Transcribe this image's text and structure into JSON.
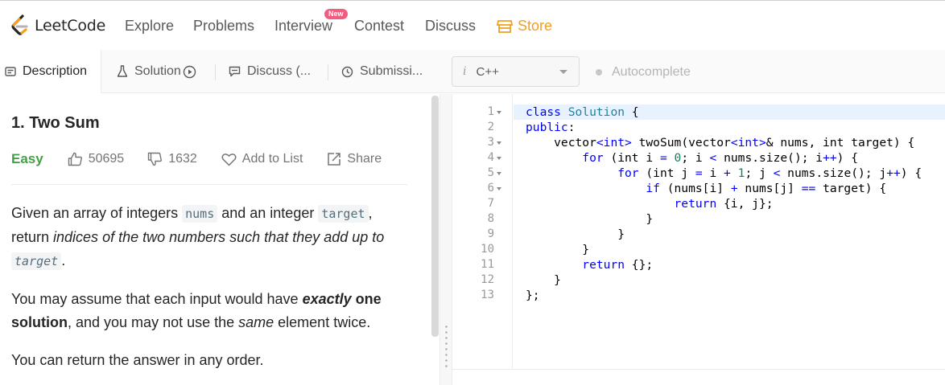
{
  "nav": {
    "logo_text": "LeetCode",
    "links": [
      "Explore",
      "Problems",
      "Interview",
      "Contest",
      "Discuss",
      "Store"
    ],
    "new_badge": "New",
    "store_color": "#f0a020"
  },
  "left_tabs": {
    "description": "Description",
    "solution": "Solution",
    "discuss": "Discuss (...",
    "submissions": "Submissi..."
  },
  "editor_toolbar": {
    "lang_icon": "i",
    "language": "C++",
    "autocomplete": "Autocomplete"
  },
  "problem": {
    "title": "1. Two Sum",
    "difficulty": "Easy",
    "difficulty_color": "#43a047",
    "likes": "50695",
    "dislikes": "1632",
    "add_to_list": "Add to List",
    "share": "Share",
    "p1": {
      "a": "Given an array of integers ",
      "code1": "nums",
      "b": " and an integer ",
      "code2": "target",
      "c": ", return ",
      "em": "indices of the two numbers such that they add up to",
      "d": " ",
      "code3": "target",
      "e": "."
    },
    "p2": {
      "a": "You may assume that each input would have ",
      "strong_em": "exactly",
      "strong": " one solution",
      "b": ", and you may not use the ",
      "em": "same",
      "c": " element twice."
    },
    "p3": "You can return the answer in any order."
  },
  "code": {
    "line_numbers": [
      "1",
      "2",
      "3",
      "4",
      "5",
      "6",
      "7",
      "8",
      "9",
      "10",
      "11",
      "12",
      "13"
    ],
    "l1_kw": "class",
    "l1_name": "Solution",
    "l1_rest": " {",
    "l2_kw": "public",
    "l2_rest": ":",
    "l3_a": "    vector",
    "l3_b": "<int>",
    "l3_c": " twoSum(vector",
    "l3_d": "<int>",
    "l3_e": "& nums, int target) {",
    "l4_kw": "for",
    "l4_a": " (int i ",
    "l4_eq": "=",
    "l4_sp": " ",
    "l4_n0": "0",
    "l4_b": "; i ",
    "l4_lt": "<",
    "l4_c": " nums.size(); i",
    "l4_pp": "++",
    "l4_d": ") {",
    "l5_kw": "for",
    "l5_a": " (int j ",
    "l5_eq": "=",
    "l5_b": " i ",
    "l5_plus": "+",
    "l5_sp": " ",
    "l5_n1": "1",
    "l5_c": "; j ",
    "l5_lt": "<",
    "l5_d": " nums.size(); j",
    "l5_pp": "++",
    "l5_e": ") {",
    "l6_kw": "if",
    "l6_a": " (nums[i] ",
    "l6_plus": "+",
    "l6_b": " nums[j] ",
    "l6_eqeq": "==",
    "l6_c": " target) {",
    "l7_kw": "return",
    "l7_rest": " {i, j};",
    "l8": "}",
    "l9": "}",
    "l10": "}",
    "l11_kw": "return",
    "l11_rest": " {};",
    "l12": "}",
    "l13": "};"
  }
}
